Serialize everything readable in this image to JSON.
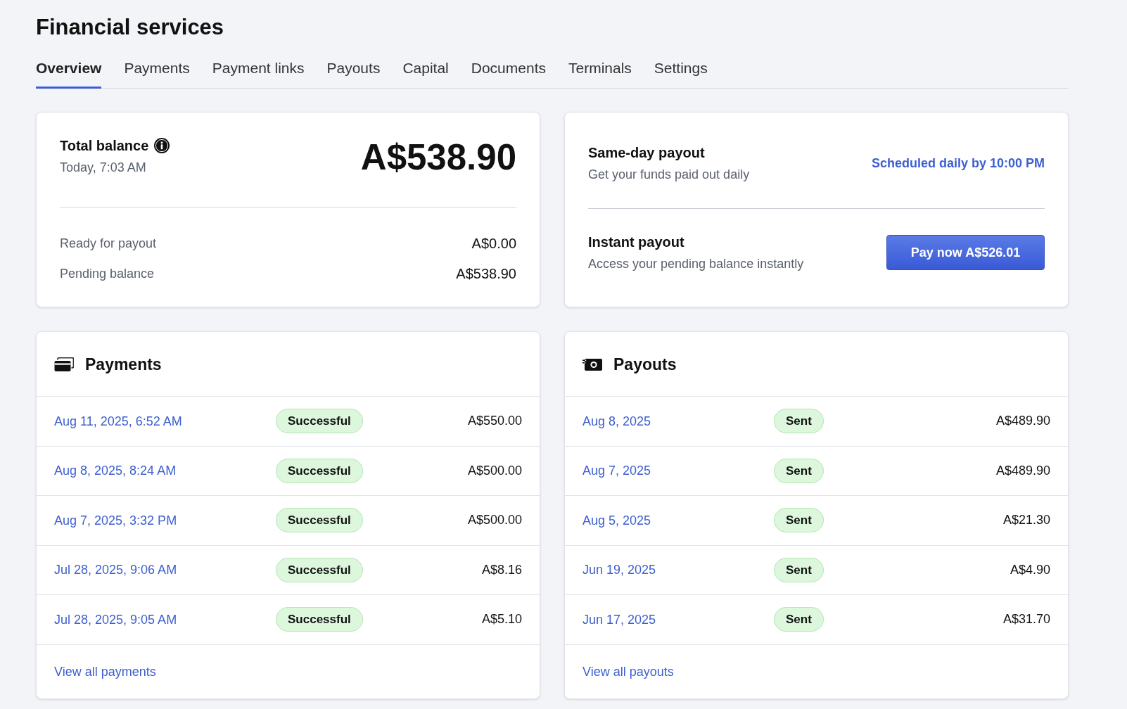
{
  "page": {
    "title": "Financial services"
  },
  "tabs": [
    {
      "label": "Overview",
      "selected": true
    },
    {
      "label": "Payments",
      "selected": false
    },
    {
      "label": "Payment links",
      "selected": false
    },
    {
      "label": "Payouts",
      "selected": false
    },
    {
      "label": "Capital",
      "selected": false
    },
    {
      "label": "Documents",
      "selected": false
    },
    {
      "label": "Terminals",
      "selected": false
    },
    {
      "label": "Settings",
      "selected": false
    }
  ],
  "balance_card": {
    "title": "Total balance",
    "timestamp": "Today, 7:03 AM",
    "amount": "A$538.90",
    "rows": [
      {
        "label": "Ready for payout",
        "value": "A$0.00"
      },
      {
        "label": "Pending balance",
        "value": "A$538.90"
      }
    ]
  },
  "payout_card": {
    "sections": [
      {
        "kind": "schedule",
        "title": "Same-day payout",
        "description": "Get your funds paid out daily",
        "action": "Scheduled daily by 10:00 PM"
      },
      {
        "kind": "button",
        "title": "Instant payout",
        "description": "Access your pending balance instantly",
        "action": "Pay now A$526.01"
      }
    ]
  },
  "payments": {
    "title": "Payments",
    "rows": [
      {
        "date": "Aug 11, 2025, 6:52 AM",
        "status": "Successful",
        "amount": "A$550.00"
      },
      {
        "date": "Aug 8, 2025, 8:24 AM",
        "status": "Successful",
        "amount": "A$500.00"
      },
      {
        "date": "Aug 7, 2025, 3:32 PM",
        "status": "Successful",
        "amount": "A$500.00"
      },
      {
        "date": "Jul 28, 2025, 9:06 AM",
        "status": "Successful",
        "amount": "A$8.16"
      },
      {
        "date": "Jul 28, 2025, 9:05 AM",
        "status": "Successful",
        "amount": "A$5.10"
      }
    ],
    "footer_link": "View all payments"
  },
  "payouts": {
    "title": "Payouts",
    "rows": [
      {
        "date": "Aug 8, 2025",
        "status": "Sent",
        "amount": "A$489.90"
      },
      {
        "date": "Aug 7, 2025",
        "status": "Sent",
        "amount": "A$489.90"
      },
      {
        "date": "Aug 5, 2025",
        "status": "Sent",
        "amount": "A$21.30"
      },
      {
        "date": "Jun 19, 2025",
        "status": "Sent",
        "amount": "A$4.90"
      },
      {
        "date": "Jun 17, 2025",
        "status": "Sent",
        "amount": "A$31.70"
      }
    ],
    "footer_link": "View all payouts"
  }
}
